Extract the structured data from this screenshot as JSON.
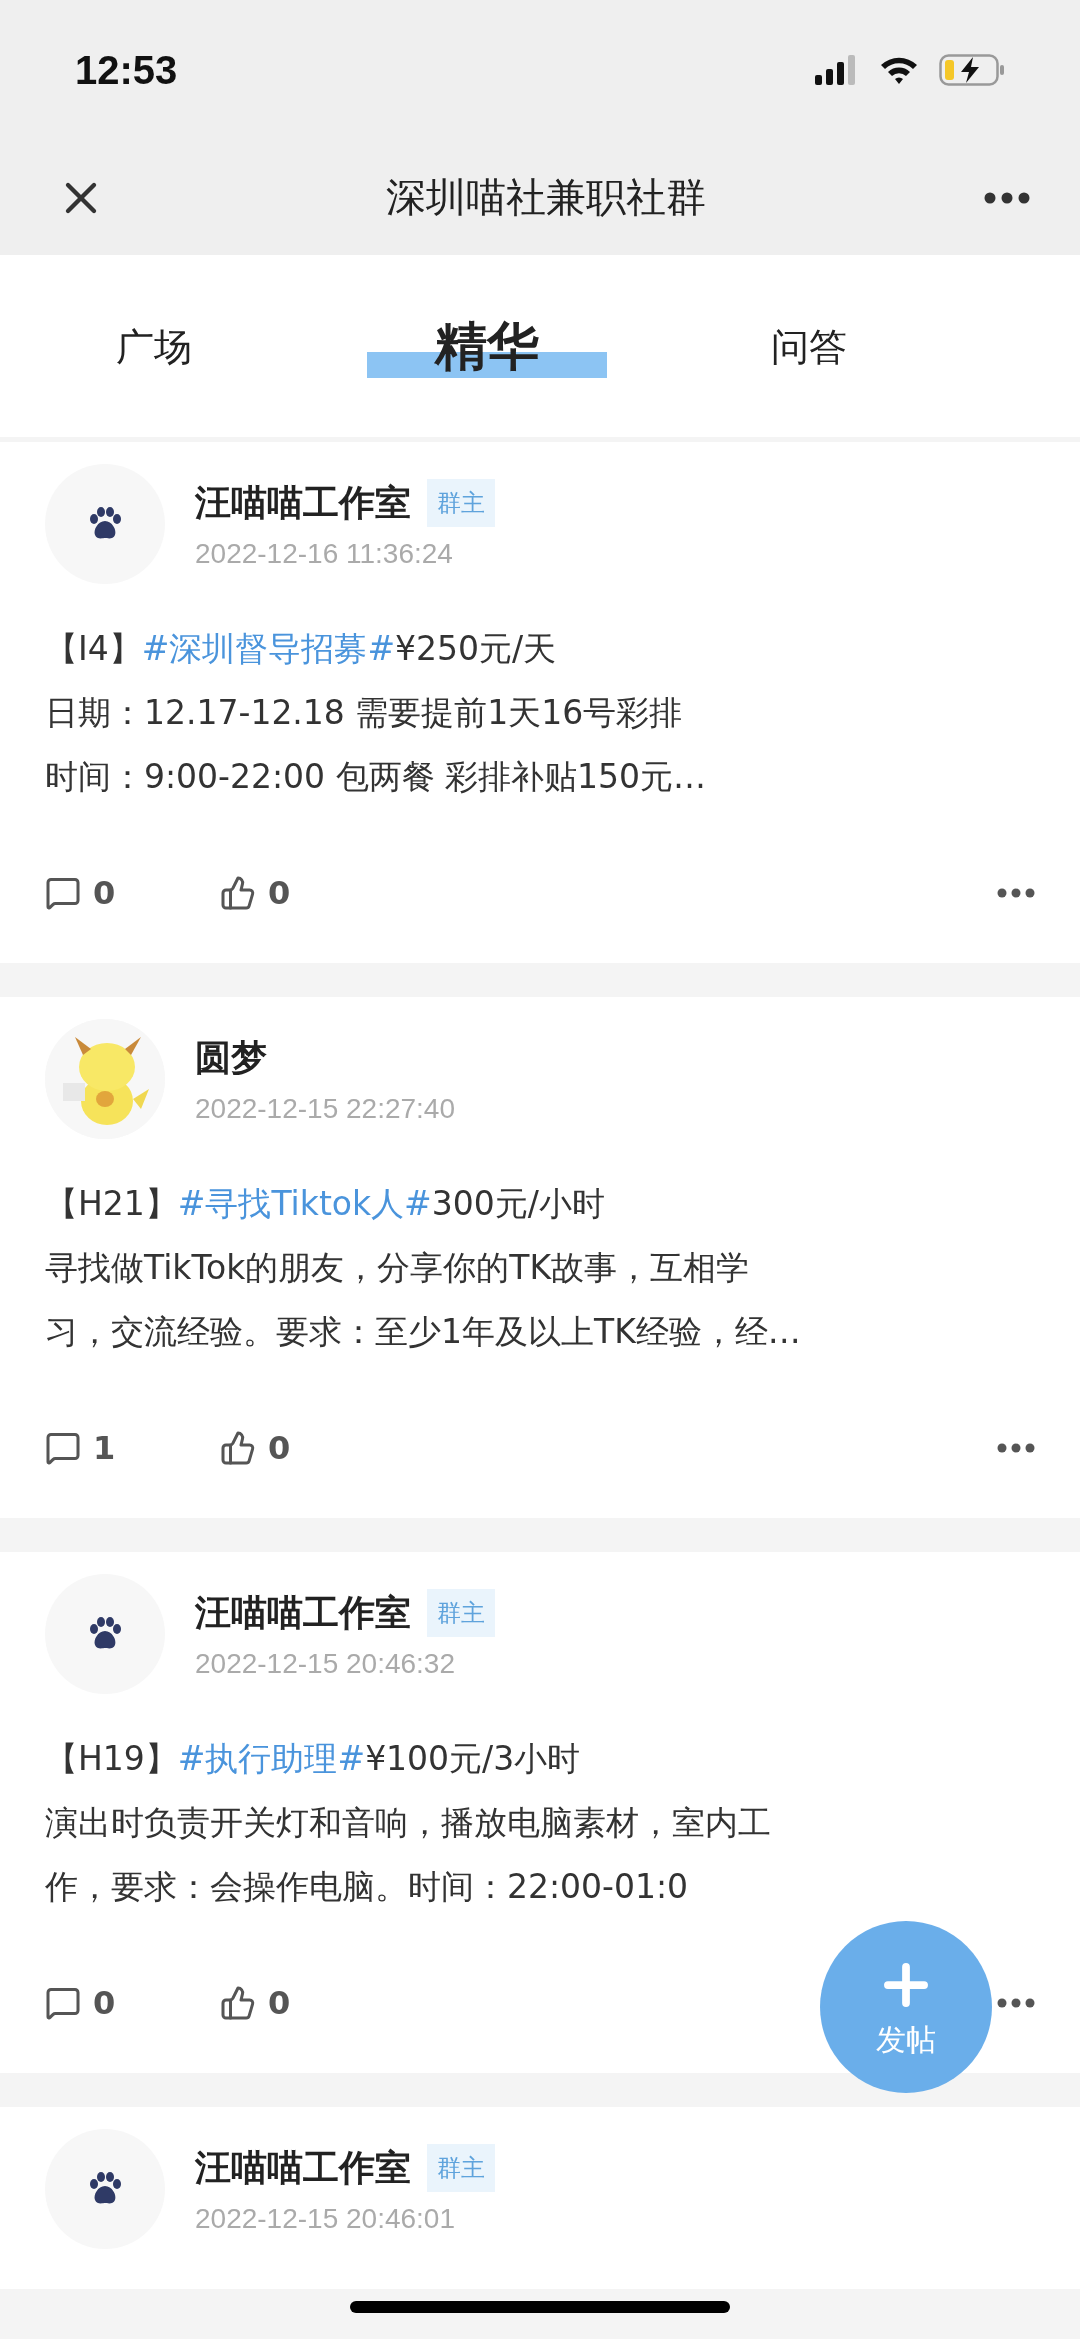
{
  "status_bar": {
    "time": "12:53"
  },
  "header": {
    "title": "深圳喵社兼职社群"
  },
  "tabs": [
    {
      "label": "广场",
      "selected": false
    },
    {
      "label": "精华",
      "selected": true
    },
    {
      "label": "问答",
      "selected": false
    }
  ],
  "posts": [
    {
      "kind": "logo",
      "author": "汪喵喵工作室",
      "badge": "群主",
      "time": "2022-12-16 11:36:24",
      "code": "【I4】",
      "topic": "#深圳督导招募#",
      "price": "¥250元/天",
      "lines": [
        "日期：12.17-12.18 需要提前1天16号彩排",
        "时间：9:00-22:00 包两餐 彩排补贴150元…"
      ],
      "comments": "0",
      "likes": "0"
    },
    {
      "kind": "picture",
      "author": "圆梦",
      "time": "2022-12-15 22:27:40",
      "code": "【H21】",
      "topic": "#寻找Tiktok人#",
      "price": "300元/小时",
      "lines": [
        "寻找做TikTok的朋友，分享你的TK故事，互相学",
        "习，交流经验。要求：至少1年及以上TK经验，经…"
      ],
      "comments": "1",
      "likes": "0"
    },
    {
      "kind": "logo",
      "author": "汪喵喵工作室",
      "badge": "群主",
      "time": "2022-12-15 20:46:32",
      "code": "【H19】",
      "topic": "#执行助理#",
      "price": "¥100元/3小时",
      "lines": [
        "演出时负责开关灯和音响，播放电脑素材，室内工",
        "作，要求：会操作电脑。时间：22:00-01:0"
      ],
      "comments": "0",
      "likes": "0"
    },
    {
      "kind": "logo",
      "author": "汪喵喵工作室",
      "badge": "群主",
      "time": "2022-12-15 20:46:01"
    }
  ],
  "fab": {
    "label": "发帖"
  }
}
